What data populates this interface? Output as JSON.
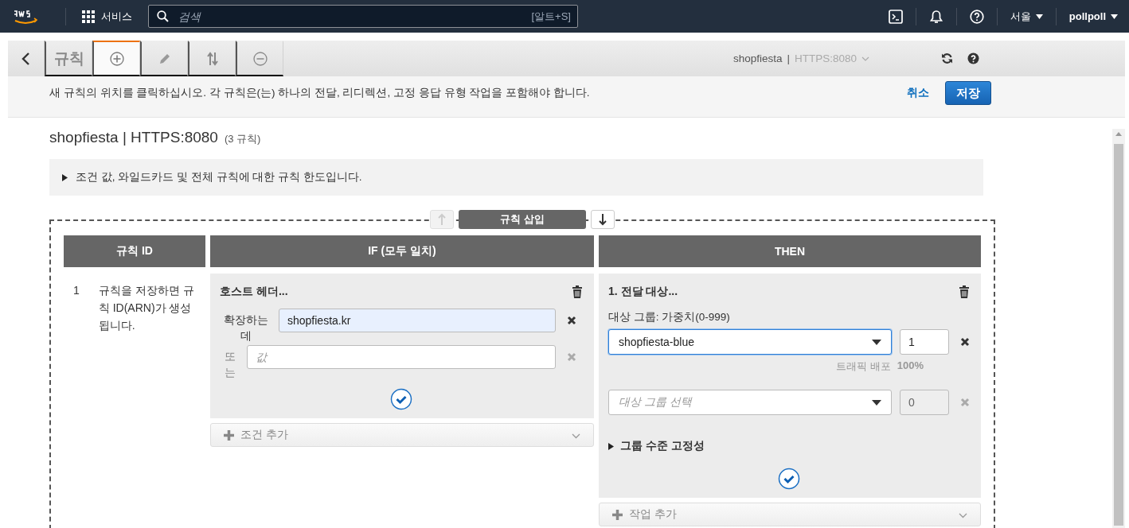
{
  "nav": {
    "services": "서비스",
    "search_placeholder": "검색",
    "search_shortcut": "[알트+S]",
    "region": "서울",
    "account": "pollpoll"
  },
  "toolbar": {
    "tabs": [
      {
        "kind": "label",
        "label": "규칙",
        "selected": false
      },
      {
        "kind": "add",
        "selected": true
      },
      {
        "kind": "edit",
        "selected": false
      },
      {
        "kind": "reorder",
        "selected": false
      },
      {
        "kind": "delete",
        "selected": false
      }
    ],
    "listener_name": "shopfiesta",
    "listener_sep": "|",
    "listener_port": "HTTPS:8080"
  },
  "info_bar": {
    "message": "새 규칙의 위치를 클릭하십시오. 각 규칙은(는) 하나의 전달, 리디렉션, 고정 응답 유형 작업을 포함해야 합니다.",
    "cancel": "취소",
    "save": "저장"
  },
  "page": {
    "title": "shopfiesta | HTTPS:8080",
    "rule_count": "(3 규칙)",
    "limits_note": "조건 값, 와일드카드 및 전체 규칙에 대한 규칙 한도입니다.",
    "limits_expanded": false
  },
  "insert": {
    "label": "규칙 삽입",
    "up_disabled": true,
    "down_disabled": false
  },
  "table": {
    "columns": [
      "규칙 ID",
      "IF (모두 일치)",
      "THEN"
    ],
    "rule": {
      "id": "1",
      "id_note": "규칙을 저장하면 규칙 ID(ARN)가 생성됩니다.",
      "condition": {
        "title": "호스트 헤더...",
        "values": [
          {
            "label": "확장하는데",
            "value": "shopfiesta.kr",
            "remove_disabled": false
          },
          {
            "label": "또는",
            "placeholder": "값",
            "remove_disabled": true
          }
        ],
        "add_label": "조건 추가"
      },
      "action": {
        "title": "1. 전달 대상...",
        "group_label": "대상 그룹: 가중치(0-999)",
        "targets": [
          {
            "value": "shopfiesta-blue",
            "weight": "1",
            "focused": true,
            "disabled": false
          },
          {
            "placeholder": "대상 그룹 선택",
            "weight": "0",
            "focused": false,
            "disabled": true
          }
        ],
        "traffic_label": "트래픽 배포",
        "traffic_value": "100%",
        "stickiness": "그룹 수준 고정성",
        "stickiness_expanded": false,
        "add_label": "작업 추가"
      }
    }
  }
}
